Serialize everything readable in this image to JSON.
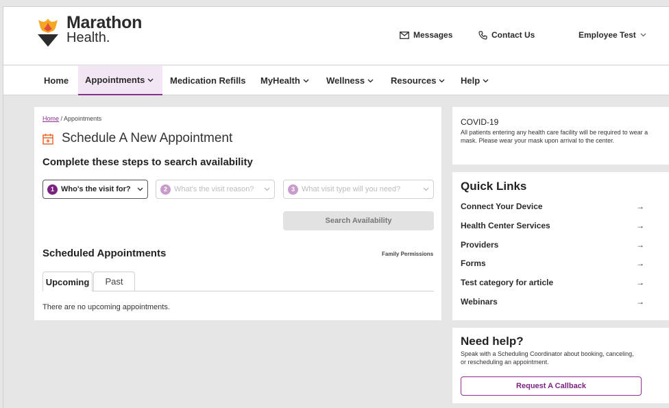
{
  "brand": {
    "name_line1": "Marathon",
    "name_line2": "Health."
  },
  "header_links": {
    "messages": "Messages",
    "contact": "Contact Us",
    "user": "Employee Test"
  },
  "nav": [
    "Home",
    "Appointments",
    "Medication Refills",
    "MyHealth",
    "Wellness",
    "Resources",
    "Help"
  ],
  "breadcrumb": {
    "home": "Home",
    "current": "Appointments"
  },
  "schedule": {
    "title": "Schedule A New Appointment",
    "steps_title": "Complete these steps to search availability",
    "steps": [
      {
        "num": "1",
        "label": "Who's the visit for?"
      },
      {
        "num": "2",
        "label": "What's the visit reason?"
      },
      {
        "num": "3",
        "label": "What visit type will you need?"
      }
    ],
    "search_button": "Search Availability"
  },
  "scheduled": {
    "title": "Scheduled Appointments",
    "family_permissions": "Family Permissions",
    "tabs": [
      "Upcoming",
      "Past"
    ],
    "empty_message": "There are no upcoming appointments."
  },
  "covid": {
    "title": "COVID-19",
    "body": "All patients entering any health care facility will be required to wear a mask. Please wear your mask upon arrival to the center."
  },
  "quick_links": {
    "title": "Quick Links",
    "items": [
      "Connect Your Device",
      "Health Center Services",
      "Providers",
      "Forms",
      "Test category for article",
      "Webinars"
    ]
  },
  "help": {
    "title": "Need help?",
    "body": "Speak with a Scheduling Coordinator about booking, canceling, or rescheduling an appointment.",
    "button": "Request A Callback"
  },
  "glyphs": {
    "arrow": "→"
  },
  "colors": {
    "accent": "#7b2381",
    "active_nav_bg": "#f2e6f4",
    "logo_orange": "#f5a623",
    "logo_dark": "#2b2b2b"
  }
}
